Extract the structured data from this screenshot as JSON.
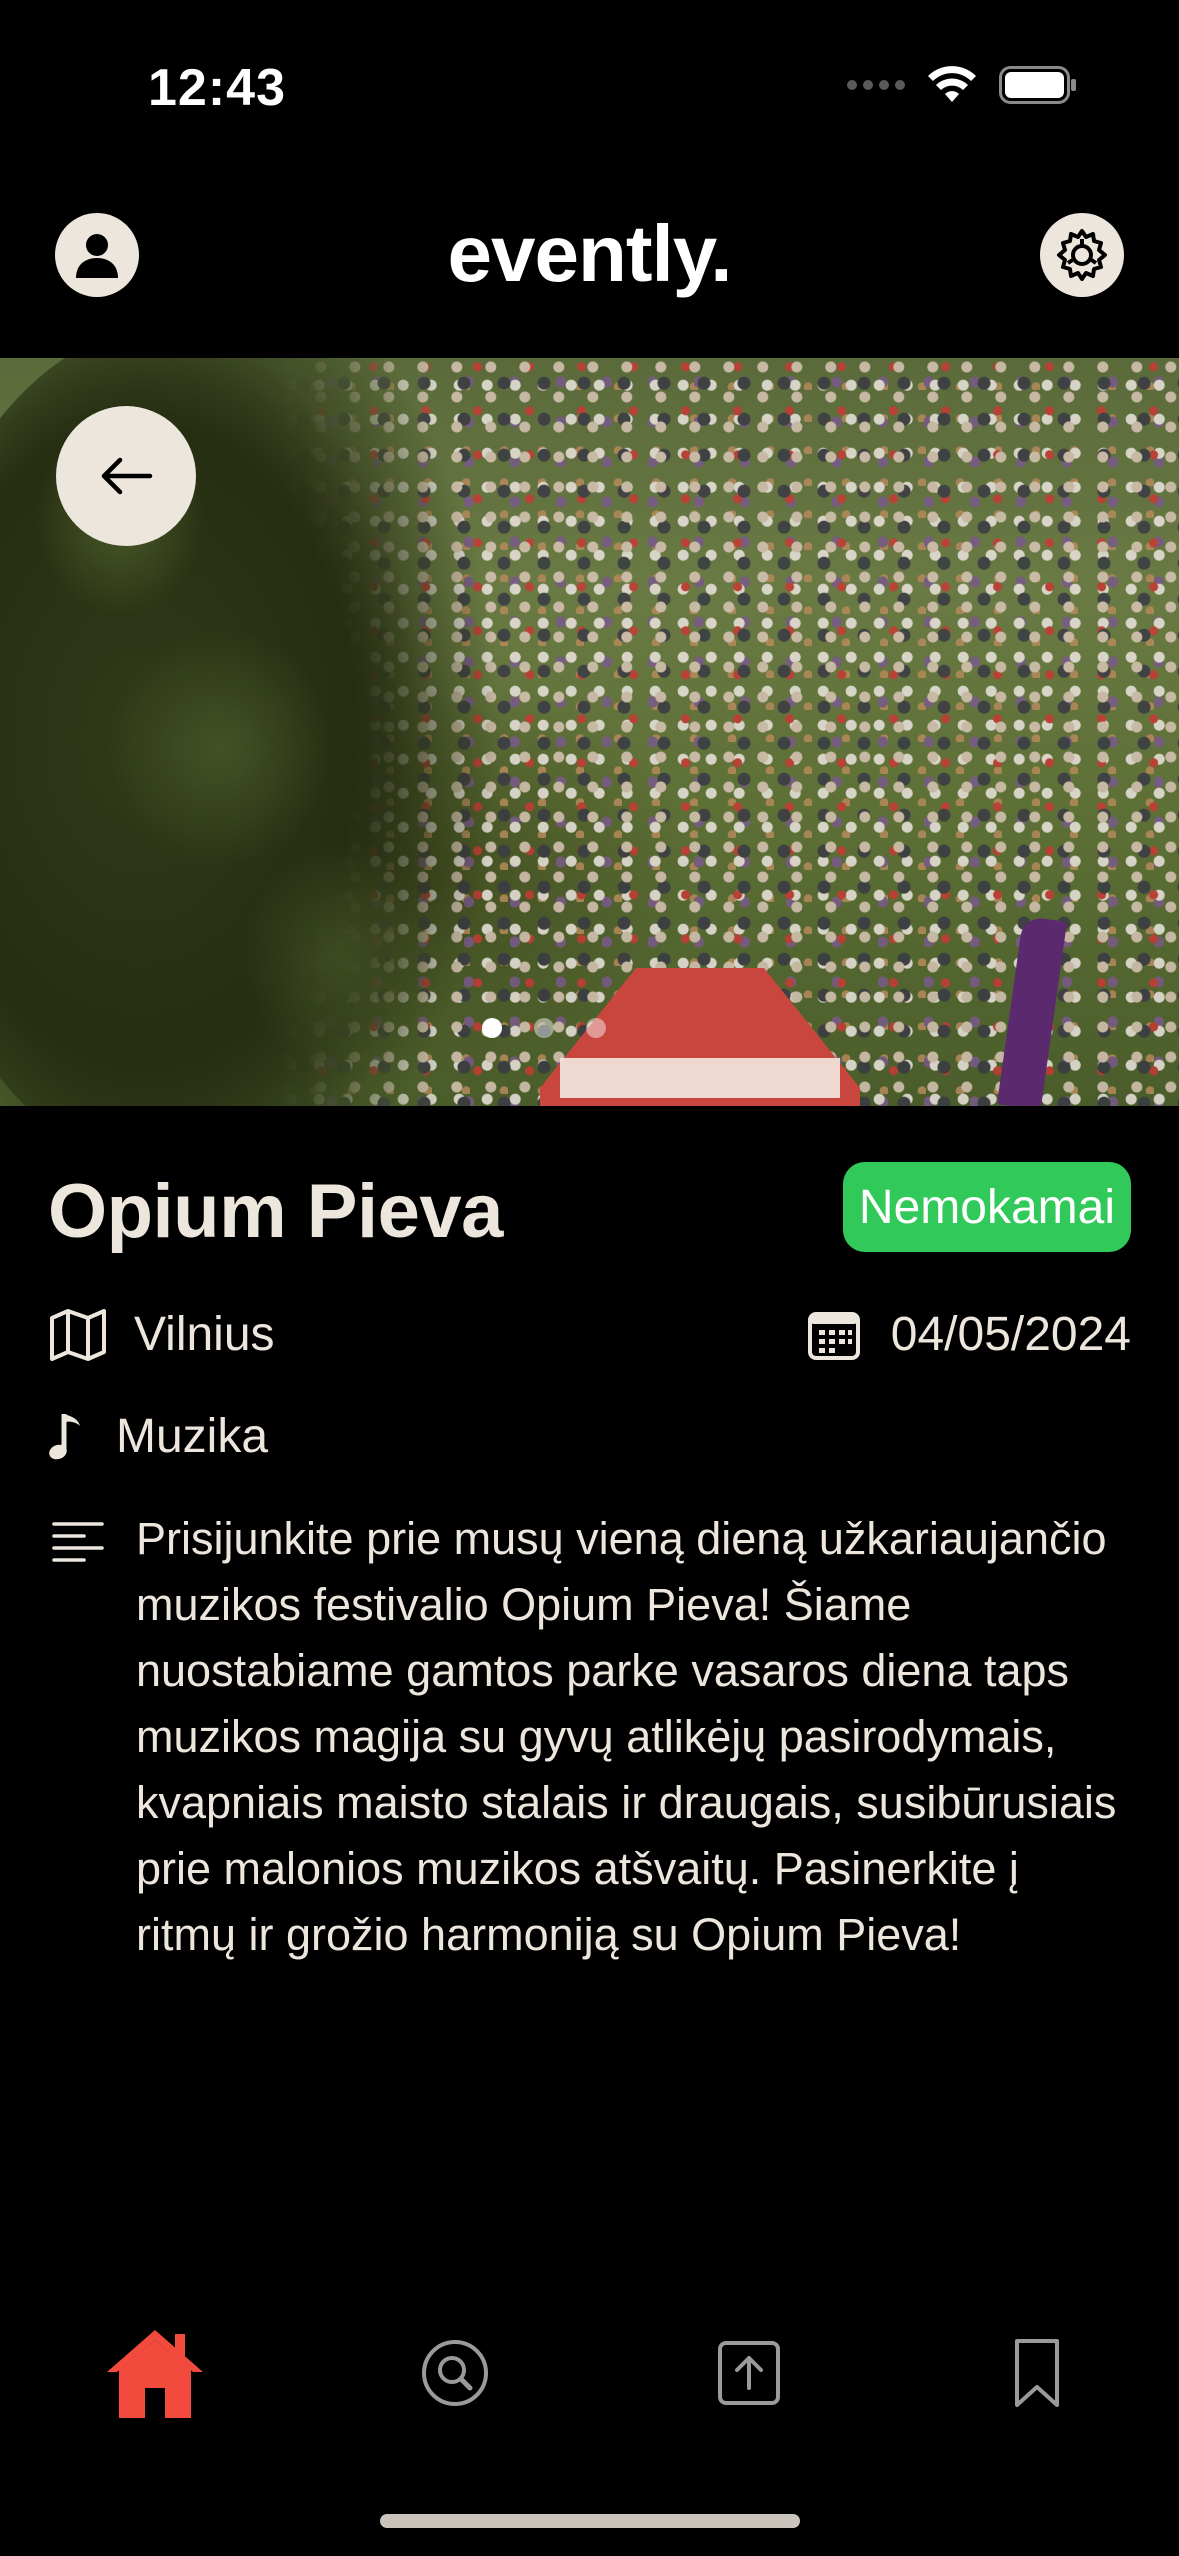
{
  "status_bar": {
    "time": "12:43",
    "icons": [
      "cellular-signal-icon",
      "wifi-icon",
      "battery-icon"
    ]
  },
  "header": {
    "title": "evently.",
    "left_icon": "user-avatar-icon",
    "right_icon": "gear-settings-icon"
  },
  "hero": {
    "back_icon": "arrow-left-icon",
    "carousel_page": 1,
    "carousel_total": 3
  },
  "event": {
    "title": "Opium Pieva",
    "price_badge": "Nemokamai",
    "location": "Vilnius",
    "date": "04/05/2024",
    "category": "Muzika",
    "description": "Prisijunkite prie musų vieną dieną užkariaujančio muzikos festivalio Opium Pieva! Šiame nuostabiame gamtos parke vasaros diena taps muzikos magija su gyvų atlikėjų pasirodymais, kvapniais maisto stalais ir draugais, susibūrusiais prie malonios muzikos atšvaitų. Pasinerkite į ritmų ir grožio harmoniją su Opium Pieva!"
  },
  "tabbar": {
    "tabs": [
      {
        "name": "home",
        "icon": "home-icon",
        "active": true
      },
      {
        "name": "search",
        "icon": "search-icon",
        "active": false
      },
      {
        "name": "upload",
        "icon": "upload-icon",
        "active": false
      },
      {
        "name": "saved",
        "icon": "bookmark-icon",
        "active": false
      }
    ]
  },
  "colors": {
    "background": "#000000",
    "text": "#EDE6DD",
    "badge_green": "#31C95A",
    "active_tab": "#F24A3C",
    "inactive_tab": "#9A9A9A"
  }
}
